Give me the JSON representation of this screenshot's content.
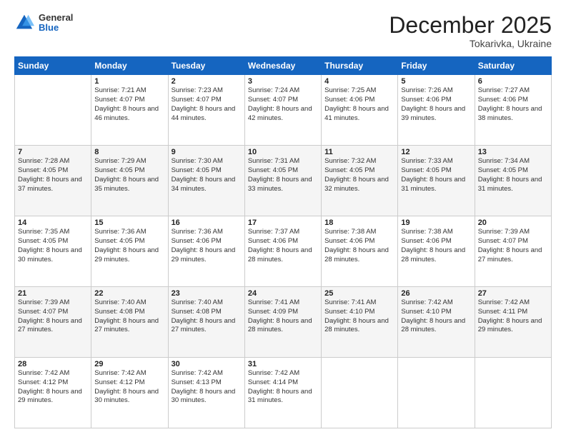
{
  "header": {
    "logo": {
      "general": "General",
      "blue": "Blue"
    },
    "title": "December 2025",
    "subtitle": "Tokarivka, Ukraine"
  },
  "weekdays": [
    "Sunday",
    "Monday",
    "Tuesday",
    "Wednesday",
    "Thursday",
    "Friday",
    "Saturday"
  ],
  "weeks": [
    [
      null,
      {
        "day": "1",
        "sunrise": "7:21 AM",
        "sunset": "4:07 PM",
        "daylight": "8 hours and 46 minutes."
      },
      {
        "day": "2",
        "sunrise": "7:23 AM",
        "sunset": "4:07 PM",
        "daylight": "8 hours and 44 minutes."
      },
      {
        "day": "3",
        "sunrise": "7:24 AM",
        "sunset": "4:07 PM",
        "daylight": "8 hours and 42 minutes."
      },
      {
        "day": "4",
        "sunrise": "7:25 AM",
        "sunset": "4:06 PM",
        "daylight": "8 hours and 41 minutes."
      },
      {
        "day": "5",
        "sunrise": "7:26 AM",
        "sunset": "4:06 PM",
        "daylight": "8 hours and 39 minutes."
      },
      {
        "day": "6",
        "sunrise": "7:27 AM",
        "sunset": "4:06 PM",
        "daylight": "8 hours and 38 minutes."
      }
    ],
    [
      {
        "day": "7",
        "sunrise": "7:28 AM",
        "sunset": "4:05 PM",
        "daylight": "8 hours and 37 minutes."
      },
      {
        "day": "8",
        "sunrise": "7:29 AM",
        "sunset": "4:05 PM",
        "daylight": "8 hours and 35 minutes."
      },
      {
        "day": "9",
        "sunrise": "7:30 AM",
        "sunset": "4:05 PM",
        "daylight": "8 hours and 34 minutes."
      },
      {
        "day": "10",
        "sunrise": "7:31 AM",
        "sunset": "4:05 PM",
        "daylight": "8 hours and 33 minutes."
      },
      {
        "day": "11",
        "sunrise": "7:32 AM",
        "sunset": "4:05 PM",
        "daylight": "8 hours and 32 minutes."
      },
      {
        "day": "12",
        "sunrise": "7:33 AM",
        "sunset": "4:05 PM",
        "daylight": "8 hours and 31 minutes."
      },
      {
        "day": "13",
        "sunrise": "7:34 AM",
        "sunset": "4:05 PM",
        "daylight": "8 hours and 31 minutes."
      }
    ],
    [
      {
        "day": "14",
        "sunrise": "7:35 AM",
        "sunset": "4:05 PM",
        "daylight": "8 hours and 30 minutes."
      },
      {
        "day": "15",
        "sunrise": "7:36 AM",
        "sunset": "4:05 PM",
        "daylight": "8 hours and 29 minutes."
      },
      {
        "day": "16",
        "sunrise": "7:36 AM",
        "sunset": "4:06 PM",
        "daylight": "8 hours and 29 minutes."
      },
      {
        "day": "17",
        "sunrise": "7:37 AM",
        "sunset": "4:06 PM",
        "daylight": "8 hours and 28 minutes."
      },
      {
        "day": "18",
        "sunrise": "7:38 AM",
        "sunset": "4:06 PM",
        "daylight": "8 hours and 28 minutes."
      },
      {
        "day": "19",
        "sunrise": "7:38 AM",
        "sunset": "4:06 PM",
        "daylight": "8 hours and 28 minutes."
      },
      {
        "day": "20",
        "sunrise": "7:39 AM",
        "sunset": "4:07 PM",
        "daylight": "8 hours and 27 minutes."
      }
    ],
    [
      {
        "day": "21",
        "sunrise": "7:39 AM",
        "sunset": "4:07 PM",
        "daylight": "8 hours and 27 minutes."
      },
      {
        "day": "22",
        "sunrise": "7:40 AM",
        "sunset": "4:08 PM",
        "daylight": "8 hours and 27 minutes."
      },
      {
        "day": "23",
        "sunrise": "7:40 AM",
        "sunset": "4:08 PM",
        "daylight": "8 hours and 27 minutes."
      },
      {
        "day": "24",
        "sunrise": "7:41 AM",
        "sunset": "4:09 PM",
        "daylight": "8 hours and 28 minutes."
      },
      {
        "day": "25",
        "sunrise": "7:41 AM",
        "sunset": "4:10 PM",
        "daylight": "8 hours and 28 minutes."
      },
      {
        "day": "26",
        "sunrise": "7:42 AM",
        "sunset": "4:10 PM",
        "daylight": "8 hours and 28 minutes."
      },
      {
        "day": "27",
        "sunrise": "7:42 AM",
        "sunset": "4:11 PM",
        "daylight": "8 hours and 29 minutes."
      }
    ],
    [
      {
        "day": "28",
        "sunrise": "7:42 AM",
        "sunset": "4:12 PM",
        "daylight": "8 hours and 29 minutes."
      },
      {
        "day": "29",
        "sunrise": "7:42 AM",
        "sunset": "4:12 PM",
        "daylight": "8 hours and 30 minutes."
      },
      {
        "day": "30",
        "sunrise": "7:42 AM",
        "sunset": "4:13 PM",
        "daylight": "8 hours and 30 minutes."
      },
      {
        "day": "31",
        "sunrise": "7:42 AM",
        "sunset": "4:14 PM",
        "daylight": "8 hours and 31 minutes."
      },
      null,
      null,
      null
    ]
  ]
}
